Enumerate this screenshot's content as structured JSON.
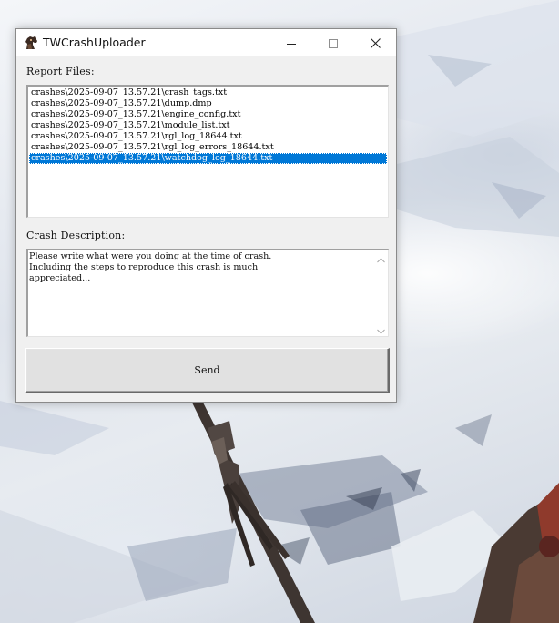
{
  "window": {
    "title": "TWCrashUploader",
    "app_icon": "horse-head-icon",
    "controls": [
      "minimize-icon",
      "maximize-icon",
      "close-icon"
    ]
  },
  "report_files": {
    "label": "Report Files:",
    "items": [
      "crashes\\2025-09-07_13.57.21\\crash_tags.txt",
      "crashes\\2025-09-07_13.57.21\\dump.dmp",
      "crashes\\2025-09-07_13.57.21\\engine_config.txt",
      "crashes\\2025-09-07_13.57.21\\module_list.txt",
      "crashes\\2025-09-07_13.57.21\\rgl_log_18644.txt",
      "crashes\\2025-09-07_13.57.21\\rgl_log_errors_18644.txt",
      "crashes\\2025-09-07_13.57.21\\watchdog_log_18644.txt"
    ],
    "selected_index": 6
  },
  "crash_description": {
    "label": "Crash Description:",
    "value": "Please write what were you doing at the time of crash.\nIncluding the steps to reproduce this crash is much\nappreciated..."
  },
  "send_button": {
    "label": "Send"
  },
  "colors": {
    "selection": "#0078d7",
    "window_bg": "#f0f0f0",
    "titlebar_bg": "#ffffff"
  }
}
